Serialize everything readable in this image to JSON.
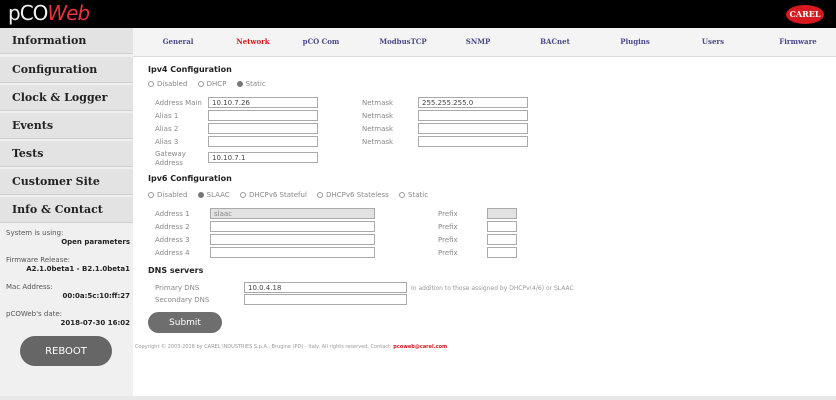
{
  "header": {
    "logo_pco": "pCO",
    "logo_web": "Web",
    "brand": "CAREL"
  },
  "sidebar": {
    "items": [
      {
        "label": "Information"
      },
      {
        "label": "Configuration"
      },
      {
        "label": "Clock & Logger"
      },
      {
        "label": "Events"
      },
      {
        "label": "Tests"
      },
      {
        "label": "Customer Site"
      },
      {
        "label": "Info & Contact"
      }
    ],
    "system_label": "System is using:",
    "system_value": "Open parameters",
    "firmware_label": "Firmware Release:",
    "firmware_value": "A2.1.0beta1 - B2.1.0beta1",
    "mac_label": "Mac Address:",
    "mac_value": "00:0a:5c:10:ff:27",
    "date_label": "pCOWeb's date:",
    "date_value": "2018-07-30 16:02",
    "reboot_label": "REBOOT"
  },
  "tabs": [
    {
      "label": "General"
    },
    {
      "label": "Network"
    },
    {
      "label": "pCO Com"
    },
    {
      "label": "ModbusTCP"
    },
    {
      "label": "SNMP"
    },
    {
      "label": "BACnet"
    },
    {
      "label": "Plugins"
    },
    {
      "label": "Users"
    },
    {
      "label": "Firmware"
    }
  ],
  "ipv4": {
    "title": "Ipv4 Configuration",
    "modes": [
      "Disabled",
      "DHCP",
      "Static"
    ],
    "selected": "Static",
    "address_label": "Address Main",
    "address_value": "10.10.7.26",
    "alias1_label": "Alias 1",
    "alias2_label": "Alias 2",
    "alias3_label": "Alias 3",
    "netmask_label": "Netmask",
    "netmask_value": "255.255.255.0",
    "gateway_label_1": "Gateway",
    "gateway_label_2": "Address",
    "gateway_value": "10.10.7.1"
  },
  "ipv6": {
    "title": "Ipv6 Configuration",
    "modes": [
      "Disabled",
      "SLAAC",
      "DHCPv6 Stateful",
      "DHCPv6 Stateless",
      "Static"
    ],
    "selected": "SLAAC",
    "address1_label": "Address 1",
    "address1_value": "slaac",
    "address2_label": "Address 2",
    "address3_label": "Address 3",
    "address4_label": "Address 4",
    "prefix_label": "Prefix"
  },
  "dns": {
    "title": "DNS servers",
    "primary_label": "Primary DNS",
    "primary_value": "10.0.4.18",
    "secondary_label": "Secondary DNS",
    "note": "In addition to those assigned by DHCPv(4/6) or SLAAC"
  },
  "submit_label": "Submit",
  "footer": {
    "text": "Copyright © 2003-2018 by CAREL INDUSTRIES S.p.A., Brugine (PD) - Italy. All rights reserved. Contact:",
    "link": "pcoweb@carel.com"
  }
}
